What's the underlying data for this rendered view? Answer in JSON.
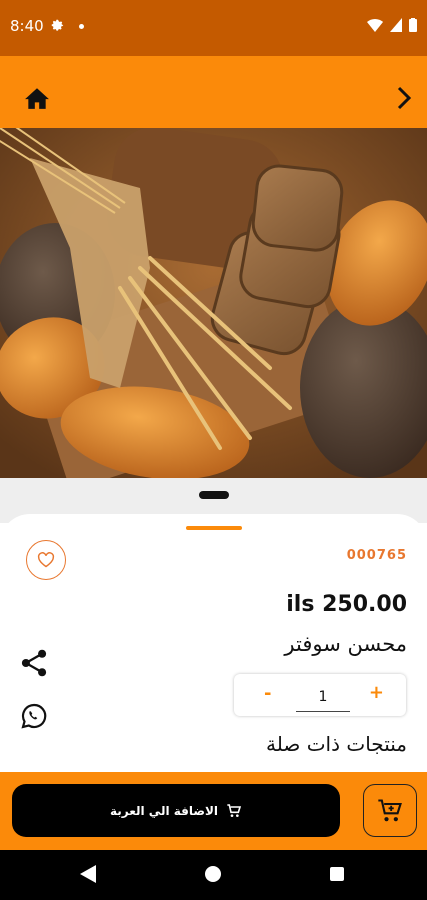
{
  "status_bar": {
    "time": "8:40"
  },
  "header": {
    "home_icon": "home-icon",
    "back_icon": "chevron-right-icon"
  },
  "product": {
    "sku": "000765",
    "price": "ils 250.00",
    "name": "محسن سوفتر",
    "quantity": "1",
    "decrement_label": "-",
    "increment_label": "+",
    "related_title": "منتجات ذات صلة"
  },
  "actions": {
    "add_to_cart_label": "الاضافة الي العربة",
    "favorite_icon": "heart-icon",
    "share_icon": "share-icon",
    "whatsapp_icon": "whatsapp-icon",
    "cart_icon": "cart-icon"
  },
  "colors": {
    "accent": "#fb8a0a",
    "status_bar": "#c45a00",
    "button": "#000000"
  }
}
